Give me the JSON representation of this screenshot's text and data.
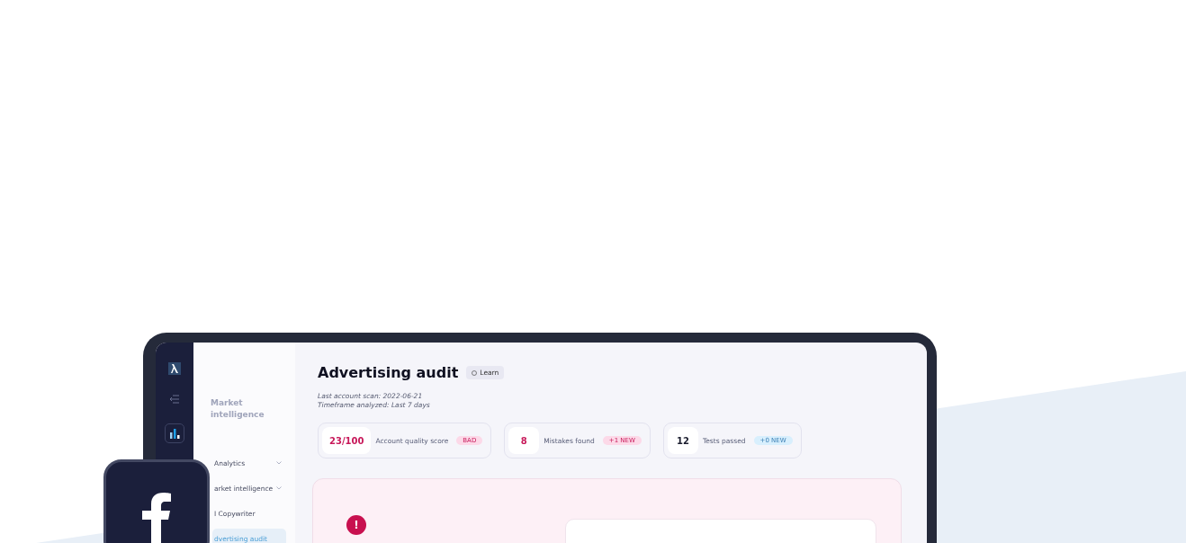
{
  "sidebar": {
    "heading": "Market intelligence",
    "items": [
      {
        "label": "Analytics",
        "expandable": true,
        "selected": false
      },
      {
        "label": "arket intelligence",
        "expandable": true,
        "selected": false
      },
      {
        "label": "I Copywriter",
        "expandable": false,
        "selected": false
      },
      {
        "label": "dvertising audit",
        "expandable": false,
        "selected": true
      }
    ]
  },
  "header": {
    "title": "Advertising audit",
    "learn_button": "Learn",
    "meta": [
      "Last account scan: 2022-06-21",
      "Timeframe analyzed: Last 7 days"
    ]
  },
  "stats": [
    {
      "value": "23/100",
      "label": "Account quality score",
      "badge": "BAD",
      "kind": "bad"
    },
    {
      "value": "8",
      "label": "Mistakes found",
      "badge": "+1 NEW",
      "kind": "bad"
    },
    {
      "value": "12",
      "label": "Tests passed",
      "badge": "+0 NEW",
      "kind": "neutral"
    }
  ],
  "alert": {
    "kind": "error",
    "icon": "!"
  }
}
